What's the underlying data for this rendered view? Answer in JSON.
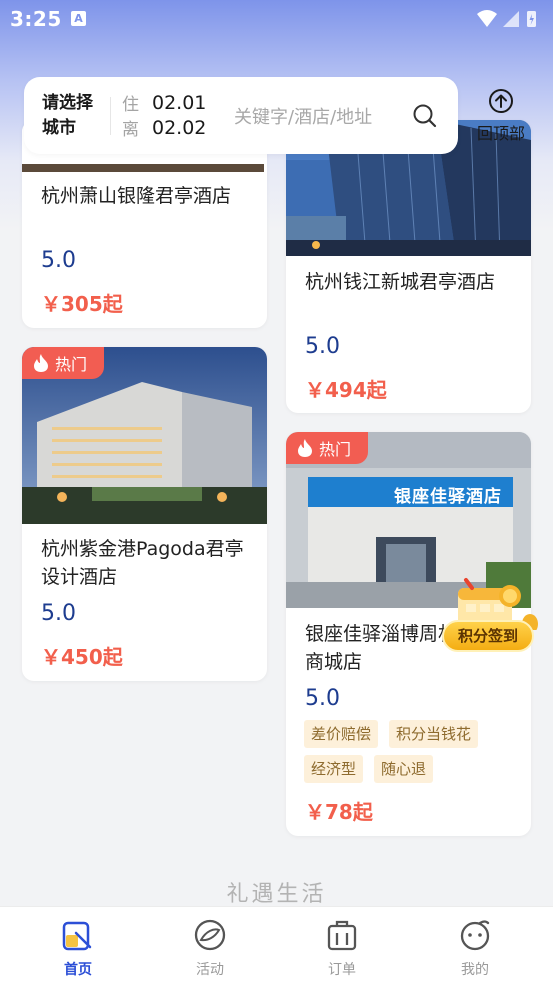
{
  "status": {
    "time": "3:25",
    "notif": "A"
  },
  "search": {
    "city_label": "请选择城市",
    "checkin_label": "住",
    "checkin_date": "02.01",
    "checkout_label": "离",
    "checkout_date": "02.02",
    "placeholder": "关键字/酒店/地址"
  },
  "back_top": {
    "label": "回顶部"
  },
  "hotels": [
    {
      "name": "杭州萧山银隆君亭酒店",
      "score": "5.0",
      "price": "￥305起"
    },
    {
      "name": "杭州钱江新城君亭酒店",
      "score": "5.0",
      "price": "￥494起"
    },
    {
      "badge": "热门",
      "name": "杭州紫金港Pagoda君亭设计酒店",
      "score": "5.0",
      "price": "￥450起"
    },
    {
      "badge": "热门",
      "sign": "银座佳驿酒店",
      "name": "银座佳驿淄博周村商城店",
      "score": "5.0",
      "price": "￥78起",
      "tags": [
        "差价赔偿",
        "积分当钱花",
        "经济型",
        "随心退"
      ]
    }
  ],
  "signin": {
    "label": "积分签到"
  },
  "section": {
    "title": "礼遇生活"
  },
  "tabs": [
    {
      "label": "首页",
      "icon": "home-icon",
      "active": true
    },
    {
      "label": "活动",
      "icon": "activity-icon",
      "active": false
    },
    {
      "label": "订单",
      "icon": "order-icon",
      "active": false
    },
    {
      "label": "我的",
      "icon": "profile-icon",
      "active": false
    }
  ],
  "colors": {
    "accent": "#2c4fd6",
    "price": "#f25f4c",
    "score": "#1d3c8f",
    "hot": "#f25d52"
  }
}
